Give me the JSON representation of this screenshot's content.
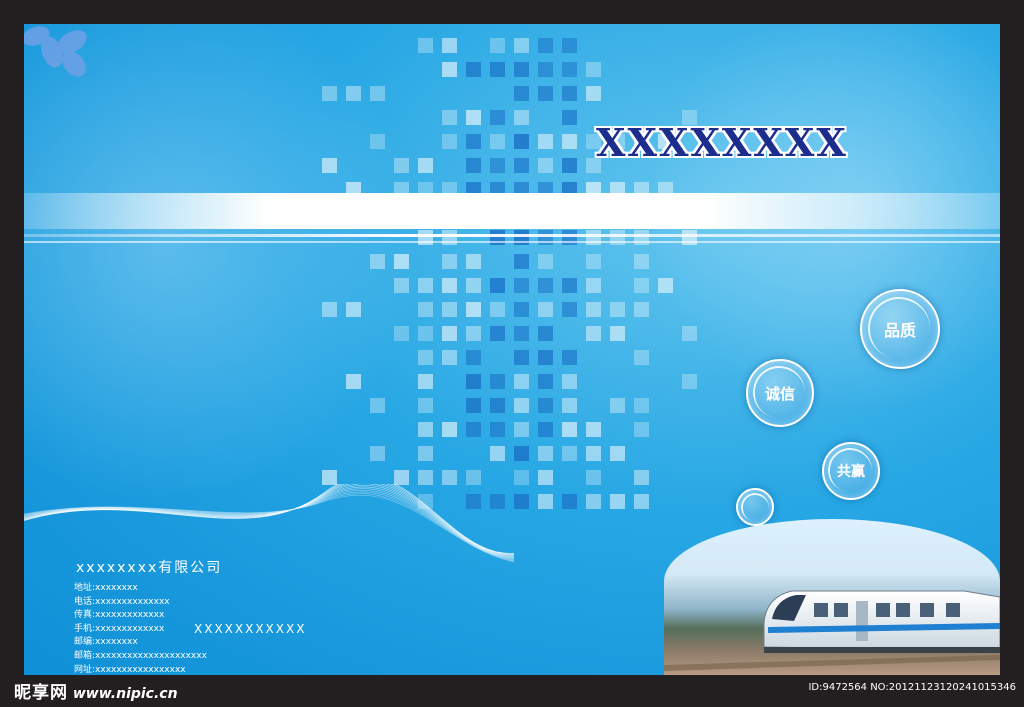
{
  "brochure": {
    "title": "XXXXXXXX",
    "values": [
      "品质",
      "诚信",
      "共赢"
    ],
    "company": "xxxxxxxx有限公司",
    "slogan": "XXXXXXXXXXX",
    "contacts": [
      {
        "label": "地址:",
        "value": "xxxxxxxx"
      },
      {
        "label": "电话:",
        "value": "xxxxxxxxxxxxxx"
      },
      {
        "label": "传真:",
        "value": "xxxxxxxxxxxxx"
      },
      {
        "label": "手机:",
        "value": "xxxxxxxxxxxxx"
      },
      {
        "label": "邮编:",
        "value": "xxxxxxxx"
      },
      {
        "label": "邮箱:",
        "value": "xxxxxxxxxxxxxxxxxxxxx"
      },
      {
        "label": "网址:",
        "value": "xxxxxxxxxxxxxxxxx"
      }
    ]
  },
  "watermark": {
    "logo": "昵享网",
    "url": "www.nipic.cn",
    "id": "ID:9472564 NO:20121123120241015346"
  },
  "colors": {
    "frame": "#231f20",
    "background": "#27a7e4",
    "title": "#1d2d8e",
    "squares": "#1e76c9"
  }
}
